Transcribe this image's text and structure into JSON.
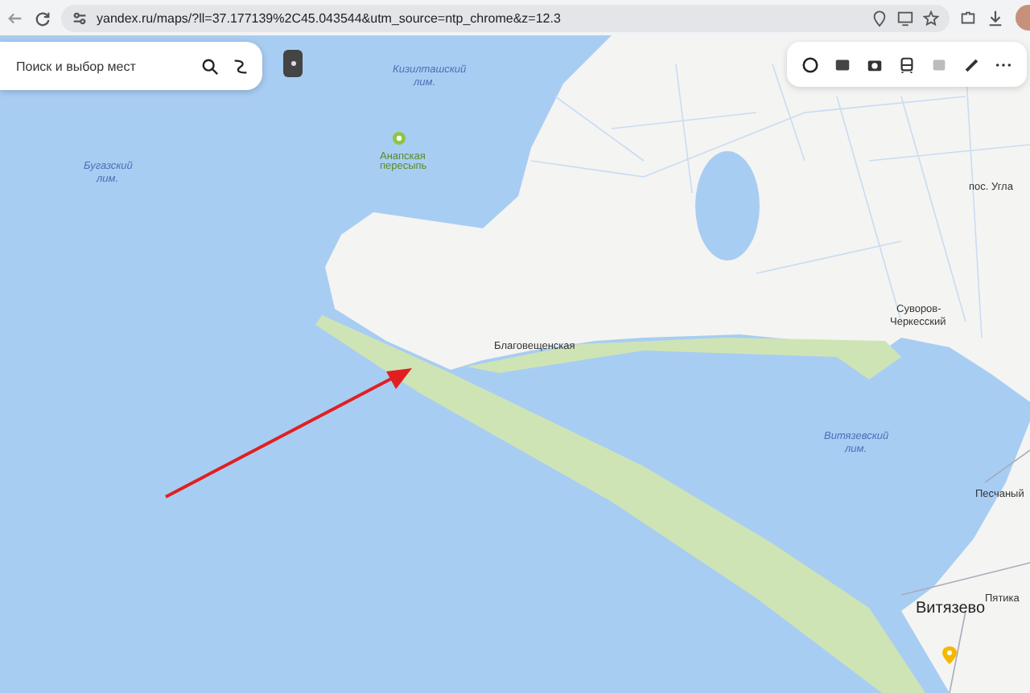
{
  "browser": {
    "url": "yandex.ru/maps/?ll=37.177139%2C45.043544&utm_source=ntp_chrome&z=12.3"
  },
  "map": {
    "search": {
      "placeholder": "Поиск и выбор мест"
    },
    "labels": [
      {
        "text": "Кизилташский",
        "kind": "water"
      },
      {
        "text": "лим.",
        "kind": "water"
      },
      {
        "text": "Бугазский",
        "kind": "water"
      },
      {
        "text": "лим.",
        "kind": "water"
      },
      {
        "text": "Анапская",
        "kind": "poi"
      },
      {
        "text": "пересыпь",
        "kind": "poi"
      },
      {
        "text": "пос. Угла",
        "kind": "place"
      },
      {
        "text": "Суворов-",
        "kind": "place"
      },
      {
        "text": "Черкесский",
        "kind": "place"
      },
      {
        "text": "Благовещенская",
        "kind": "place"
      },
      {
        "text": "Витязевский",
        "kind": "water"
      },
      {
        "text": "лим.",
        "kind": "water"
      },
      {
        "text": "Песчаный",
        "kind": "place"
      },
      {
        "text": "Витязево",
        "kind": "town"
      },
      {
        "text": "Пятика",
        "kind": "place"
      }
    ]
  }
}
